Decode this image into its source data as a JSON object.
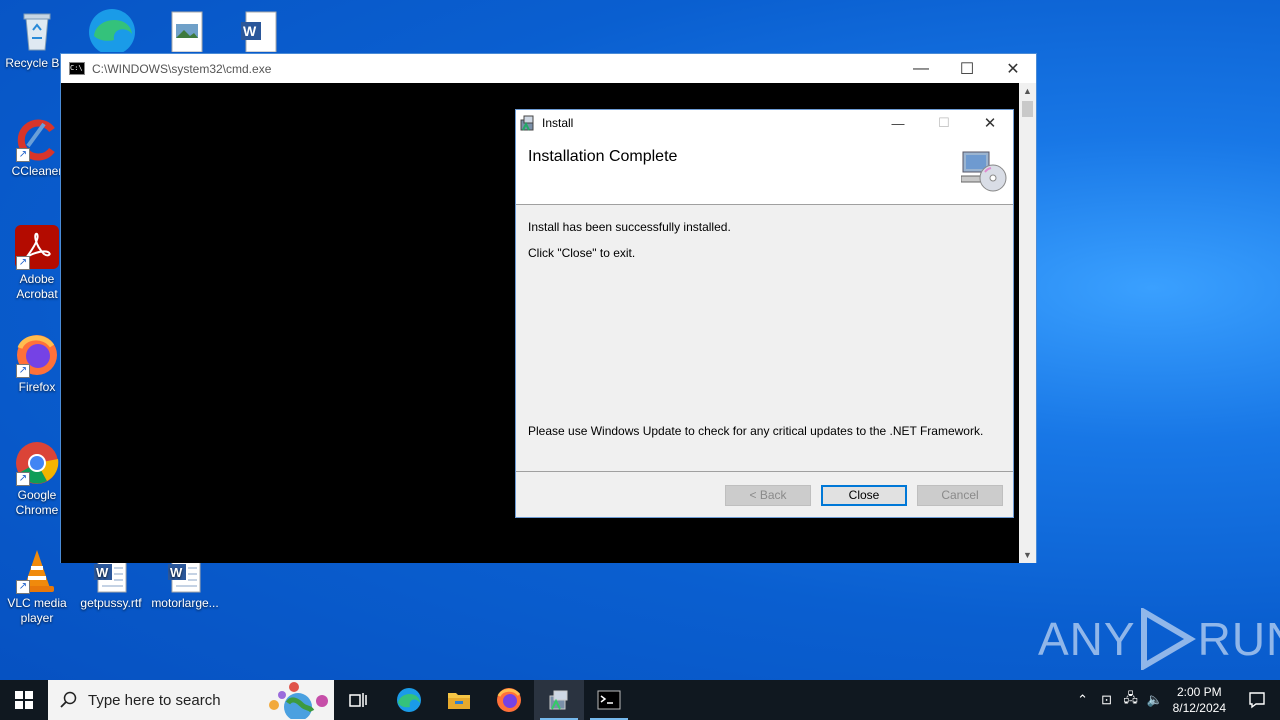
{
  "desktop": {
    "icons": [
      {
        "label": "Recycle Bin",
        "icon": "recycle-bin-icon"
      },
      {
        "label": "CCleaner",
        "icon": "ccleaner-icon"
      },
      {
        "label": "Adobe Acrobat",
        "icon": "adobe-acrobat-icon"
      },
      {
        "label": "Firefox",
        "icon": "firefox-icon"
      },
      {
        "label": "Google Chrome",
        "icon": "chrome-icon"
      },
      {
        "label": "VLC media player",
        "icon": "vlc-icon"
      },
      {
        "label": "getpussy.rtf",
        "icon": "word-document-icon"
      },
      {
        "label": "motorlarge...",
        "icon": "word-document-icon"
      }
    ]
  },
  "cmd_window": {
    "title": "C:\\WINDOWS\\system32\\cmd.exe"
  },
  "install_dialog": {
    "title": "Install",
    "heading": "Installation Complete",
    "line1": "Install has been successfully installed.",
    "line2": "Click \"Close\" to exit.",
    "line3": "Please use Windows Update to check for any critical updates to the .NET Framework.",
    "buttons": {
      "back": "< Back",
      "close": "Close",
      "cancel": "Cancel"
    }
  },
  "watermark": {
    "left": "ANY",
    "right": "RUN"
  },
  "taskbar": {
    "search_placeholder": "Type here to search",
    "time": "2:00 PM",
    "date": "8/12/2024"
  },
  "colors": {
    "desktop_blue": "#0a5fd0",
    "accent": "#0078d7",
    "taskbar": "#101820"
  }
}
